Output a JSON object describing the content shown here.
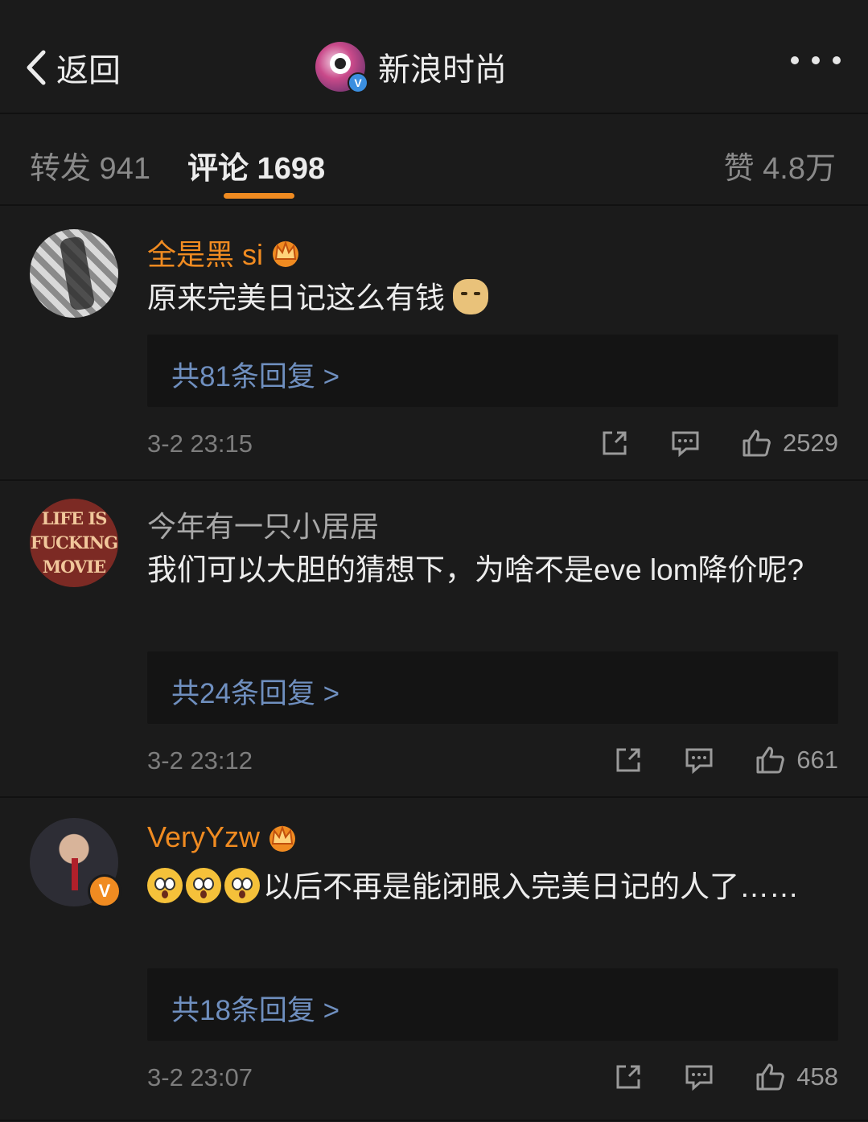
{
  "nav": {
    "back_label": "返回",
    "account_name": "新浪时尚",
    "verified_badge": "V"
  },
  "tabs": {
    "repost": "转发 941",
    "comments": "评论 1698",
    "likes": "赞 4.8万"
  },
  "comments": [
    {
      "username": "全是黑 si",
      "text": "原来完美日记这么有钱",
      "replies": "共81条回复 >",
      "time": "3-2 23:15",
      "likes": "2529"
    },
    {
      "username": "今年有一只小居居",
      "text": "我们可以大胆的猜想下，为啥不是eve lom降价呢?",
      "replies": "共24条回复 >",
      "time": "3-2 23:12",
      "likes": "661",
      "avatar_text": [
        "LIFE IS",
        "FUCKING",
        "MOVIE"
      ]
    },
    {
      "username": "VeryYzw",
      "text": "以后不再是能闭眼入完美日记的人了……",
      "replies": "共18条回复 >",
      "time": "3-2 23:07",
      "likes": "458",
      "avatar_badge": "V"
    }
  ],
  "colors": {
    "accent": "#f08b21",
    "reply_link": "#6f8fbf",
    "background": "#1b1b1b"
  }
}
